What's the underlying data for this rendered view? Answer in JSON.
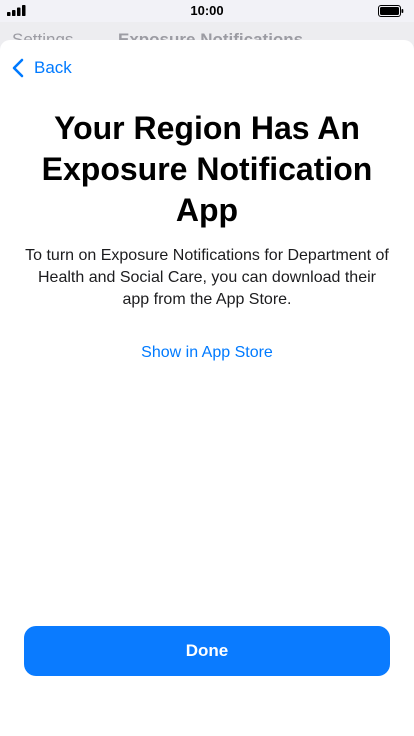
{
  "status_bar": {
    "time": "10:00",
    "icons": [
      "signal-icon",
      "battery-icon"
    ]
  },
  "background_nav": {
    "back_label": "Settings",
    "title": "Exposure Notifications"
  },
  "sheet": {
    "back_label": "Back",
    "back_icon": "chevron-left-icon",
    "title": "Your Region Has An Exposure Notification App",
    "body": "To turn on Exposure Notifications for Department of Health and Social Care, you can download their app from the App Store.",
    "store_link": "Show in App Store",
    "done_label": "Done"
  },
  "colors": {
    "accent": "#007aff",
    "button_bg": "#0a7bff",
    "sheet_bg": "#ffffff",
    "backdrop": "#d1d1d6"
  }
}
